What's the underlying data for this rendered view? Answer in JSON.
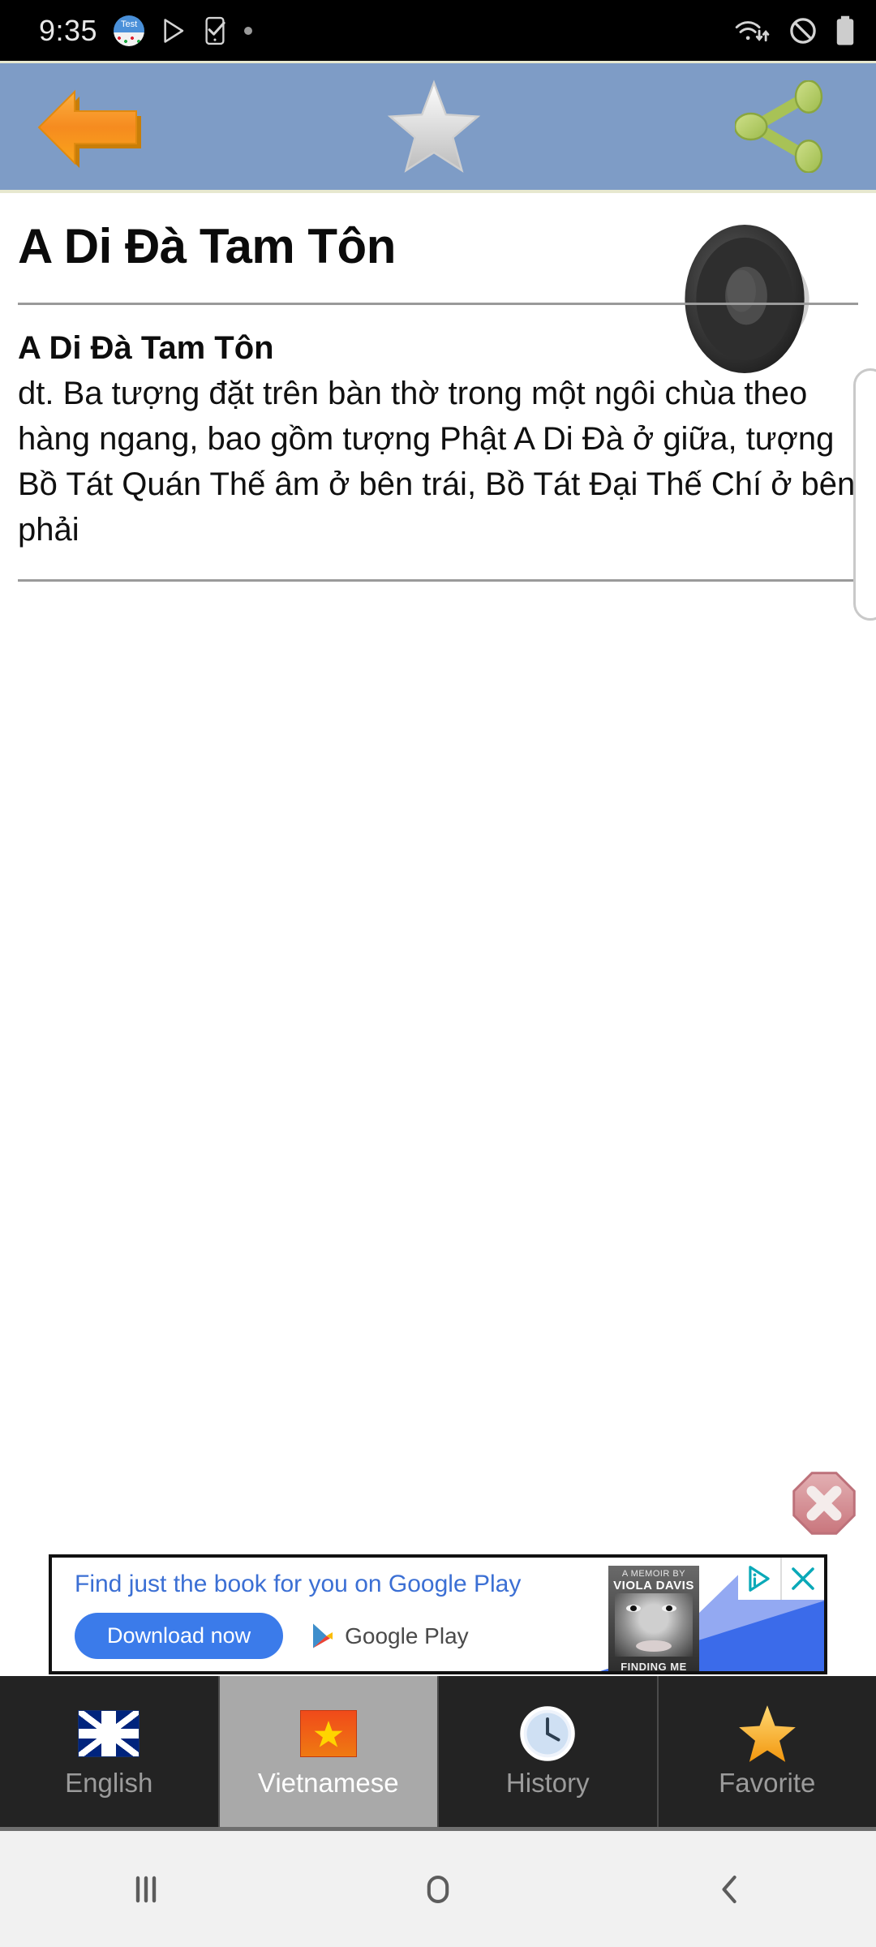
{
  "status_bar": {
    "time": "9:35",
    "left_icons": [
      "test-app-icon",
      "play-store-icon",
      "phone-check-icon",
      "dot-icon"
    ],
    "right_icons": [
      "wifi-transfer-icon",
      "do-not-disturb-icon",
      "battery-icon"
    ]
  },
  "toolbar": {
    "back_label": "back-arrow",
    "star_label": "star",
    "share_label": "share",
    "background_color": "#7e9cc6"
  },
  "entry": {
    "title": "A Di Đà Tam Tôn",
    "headword": "A Di Đà Tam Tôn",
    "definition": "dt. Ba tượng đặt trên bàn thờ trong một ngôi chùa theo hàng ngang, bao gồm tượng Phật A Di Đà ở giữa, tượng Bồ Tát Quán Thế âm ở bên trái, Bồ Tát Đại Thế Chí ở bên phải",
    "speak_icon": "speaker-icon"
  },
  "ad": {
    "headline": "Find just the book for you on Google Play",
    "cta_label": "Download now",
    "brand_label": "Google Play",
    "book_top_text": "A MEMOIR BY",
    "book_author": "VIOLA DAVIS",
    "book_title": "FINDING ME",
    "adchoices_icon": "adchoices-icon",
    "close_icon": "close-icon",
    "cta_color": "#3b7bea",
    "headline_color": "#3b6fd4"
  },
  "ad_close_button": {
    "icon": "octagon-close-icon",
    "color": "#d08a90"
  },
  "tabs": [
    {
      "label": "English",
      "icon": "uk-flag-icon",
      "selected": false
    },
    {
      "label": "Vietnamese",
      "icon": "vietnam-flag-icon",
      "selected": true
    },
    {
      "label": "History",
      "icon": "clock-icon",
      "selected": false
    },
    {
      "label": "Favorite",
      "icon": "star-icon",
      "selected": false
    }
  ],
  "nav_bar": {
    "recents_label": "recents",
    "home_label": "home",
    "back_label": "back"
  }
}
